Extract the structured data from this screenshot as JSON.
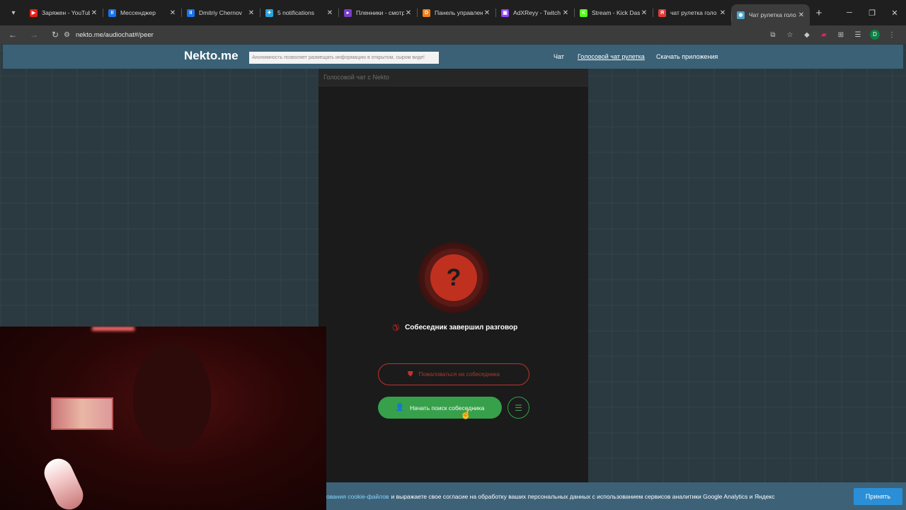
{
  "browser": {
    "tabs": [
      {
        "title": "Заряжен - YouTube",
        "favicon_color": "#e62117",
        "favicon_glyph": "▶"
      },
      {
        "title": "Мессенджер",
        "favicon_color": "#1a73e8",
        "favicon_glyph": "II"
      },
      {
        "title": "Dmitriy Chernov",
        "favicon_color": "#1a73e8",
        "favicon_glyph": "II"
      },
      {
        "title": "5 notifications",
        "favicon_color": "#2aa3dd",
        "favicon_glyph": "✈"
      },
      {
        "title": "Пленники - смотр",
        "favicon_color": "#7a3cc7",
        "favicon_glyph": "▸"
      },
      {
        "title": "Панель управлени",
        "favicon_color": "#f07f1c",
        "favicon_glyph": "D"
      },
      {
        "title": "AdXReyy - Twitch",
        "favicon_color": "#9146ff",
        "favicon_glyph": "▣"
      },
      {
        "title": "Stream - Kick Dash",
        "favicon_color": "#53fc18",
        "favicon_glyph": "K"
      },
      {
        "title": "чат рулетка голо",
        "favicon_color": "#e03a3a",
        "favicon_glyph": "Я"
      },
      {
        "title": "Чат рулетка голо",
        "favicon_color": "#4aa3c7",
        "favicon_glyph": "◉",
        "active": true
      }
    ],
    "url": "nekto.me/audiochat#/peer",
    "profile_initial": "D"
  },
  "site": {
    "logo": "Nekto.me",
    "notice": "Анонимность позволяет размещать информацию в открытом, сыром виде!",
    "nav": {
      "chat": "Чат",
      "voice_roulette": "Голосовой чат рулетка",
      "download_apps": "Скачать приложения"
    }
  },
  "chat": {
    "title": "Голосовой чат с Nekto",
    "status_icon": "question-mark",
    "status_glyph": "?",
    "ended_text": "Собеседник завершил разговор",
    "report_label": "Пожаловаться на собеседника",
    "search_label": "Начать поиск собеседника"
  },
  "cookie": {
    "link_text": "ования cookie-файлов",
    "text": "и выражаете свое согласие на обработку ваших персональных данных с использованием сервисов аналитики Google Analytics и Яндекс",
    "accept_label": "Принять"
  }
}
